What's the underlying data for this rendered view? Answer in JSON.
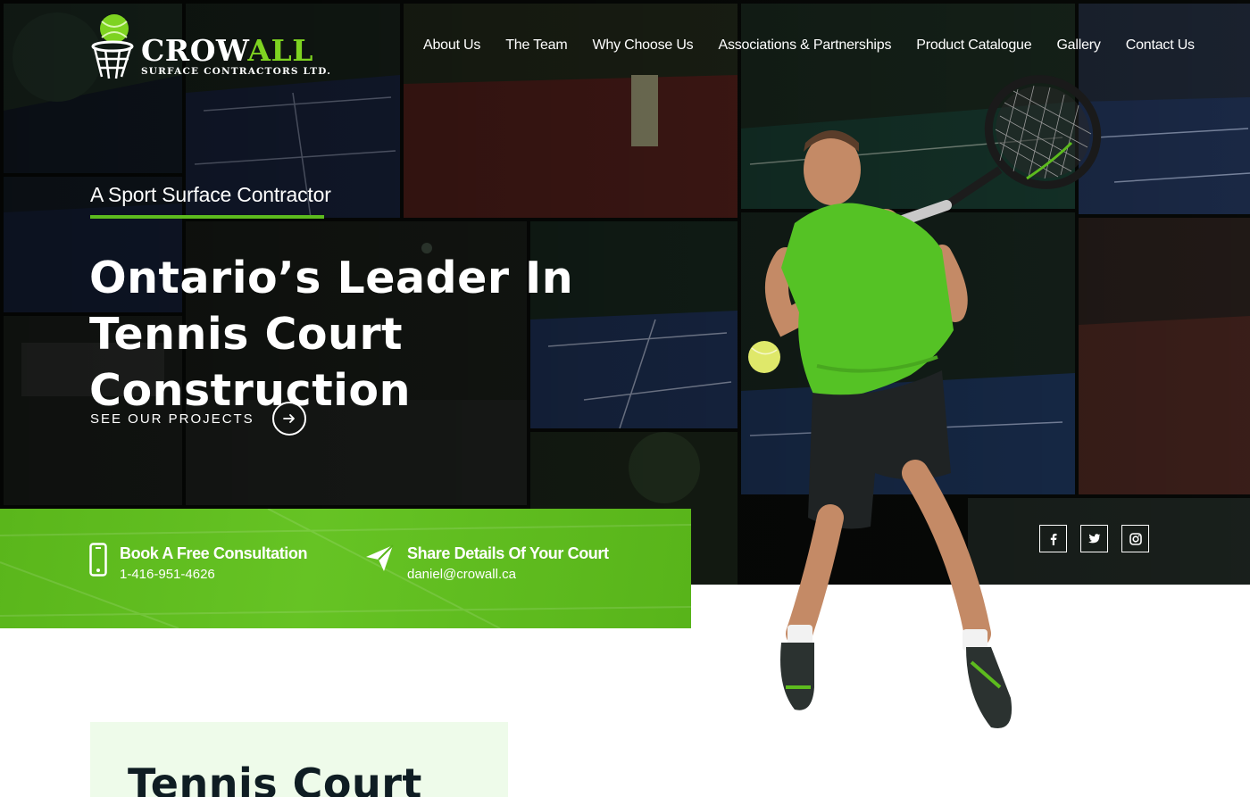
{
  "brand": {
    "name_part1": "CROW",
    "name_part2": "ALL",
    "subtitle": "SURFACE CONTRACTORS LTD.",
    "accent": "#5dbb1e"
  },
  "nav": {
    "items": [
      {
        "label": "About Us"
      },
      {
        "label": "The Team"
      },
      {
        "label": "Why Choose Us"
      },
      {
        "label": "Associations & Partnerships"
      },
      {
        "label": "Product Catalogue"
      },
      {
        "label": "Gallery"
      },
      {
        "label": "Contact Us"
      }
    ]
  },
  "hero": {
    "tagline": "A Sport Surface Contractor",
    "headline": "Ontario’s Leader In Tennis Court Construction",
    "cta_label": "SEE OUR PROJECTS"
  },
  "contact": {
    "consult_title": "Book A Free Consultation",
    "phone": "1-416-951-4626",
    "share_title": "Share Details Of Your Court",
    "email": "daniel@crowall.ca"
  },
  "social": {
    "icons": [
      "facebook-icon",
      "twitter-icon",
      "instagram-icon"
    ]
  },
  "section": {
    "title": "Tennis Court"
  }
}
